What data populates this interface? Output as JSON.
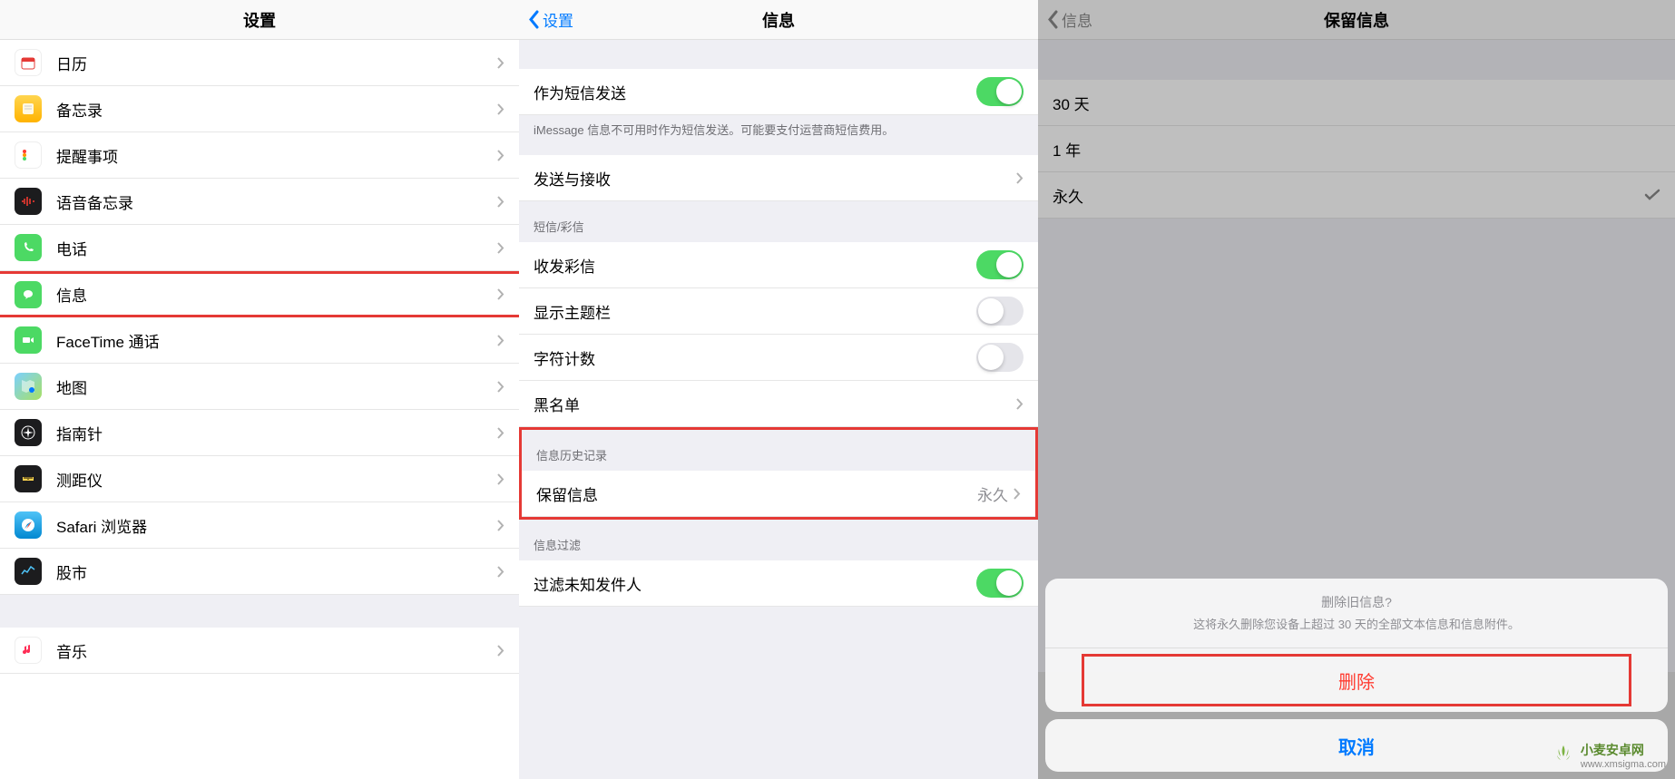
{
  "screen1": {
    "title": "设置",
    "items": [
      {
        "label": "日历"
      },
      {
        "label": "备忘录"
      },
      {
        "label": "提醒事项"
      },
      {
        "label": "语音备忘录"
      },
      {
        "label": "电话"
      },
      {
        "label": "信息"
      },
      {
        "label": "FaceTime 通话"
      },
      {
        "label": "地图"
      },
      {
        "label": "指南针"
      },
      {
        "label": "测距仪"
      },
      {
        "label": "Safari 浏览器"
      },
      {
        "label": "股市"
      },
      {
        "label": "音乐"
      }
    ]
  },
  "screen2": {
    "back": "设置",
    "title": "信息",
    "send_as_sms": "作为短信发送",
    "sms_footer": "iMessage 信息不可用时作为短信发送。可能要支付运营商短信费用。",
    "send_receive": "发送与接收",
    "mms_section": "短信/彩信",
    "mms": "收发彩信",
    "subject": "显示主题栏",
    "char_count": "字符计数",
    "blocklist": "黑名单",
    "history_section": "信息历史记录",
    "keep_messages": "保留信息",
    "keep_value": "永久",
    "filter_section": "信息过滤",
    "filter_unknown": "过滤未知发件人"
  },
  "screen3": {
    "back": "信息",
    "title": "保留信息",
    "options": [
      {
        "label": "30 天"
      },
      {
        "label": "1 年"
      },
      {
        "label": "永久"
      }
    ],
    "sheet": {
      "title": "删除旧信息?",
      "message": "这将永久删除您设备上超过 30 天的全部文本信息和信息附件。",
      "delete": "删除",
      "cancel": "取消"
    }
  },
  "watermark": {
    "name": "小麦安卓网",
    "url": "www.xmsigma.com"
  }
}
